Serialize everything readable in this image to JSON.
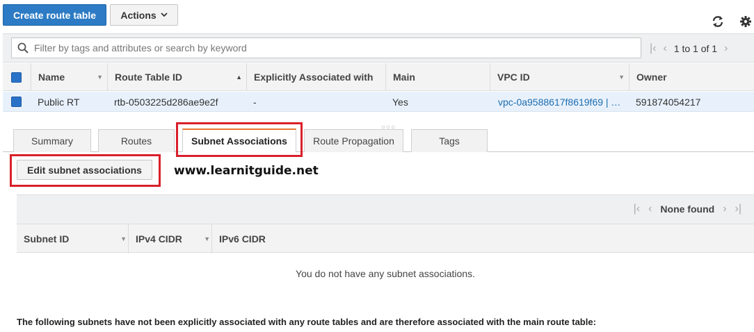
{
  "toolbar": {
    "create_label": "Create route table",
    "actions_label": "Actions",
    "icons": [
      "refresh-icon",
      "gear-icon",
      "caret-down-icon"
    ]
  },
  "filter": {
    "placeholder": "Filter by tags and attributes or search by keyword",
    "pagination": "1 to 1 of 1"
  },
  "table": {
    "columns": [
      "Name",
      "Route Table ID",
      "Explicitly Associated with",
      "Main",
      "VPC ID",
      "Owner"
    ],
    "rows": [
      {
        "name": "Public RT",
        "route_table_id": "rtb-0503225d286ae9e2f",
        "explicitly_associated": "-",
        "main": "Yes",
        "vpc_id": "vpc-0a9588617f8619f69 | …",
        "owner": "591874054217"
      }
    ]
  },
  "tabs": [
    {
      "label": "Summary",
      "active": false
    },
    {
      "label": "Routes",
      "active": false
    },
    {
      "label": "Subnet Associations",
      "active": true
    },
    {
      "label": "Route Propagation",
      "active": false
    },
    {
      "label": "Tags",
      "active": false
    }
  ],
  "subnet_panel": {
    "edit_label": "Edit subnet associations",
    "watermark": "www.learnitguide.net",
    "pagination": "None found",
    "columns": [
      "Subnet ID",
      "IPv4 CIDR",
      "IPv6 CIDR"
    ],
    "empty_message": "You do not have any subnet associations.",
    "footer_note": "The following subnets have not been explicitly associated with any route tables and are therefore associated with the main route table:"
  },
  "colors": {
    "primary": "#2c7bc4",
    "highlight": "#d9202a",
    "active_tab_accent": "#e6772e",
    "link": "#1c6cb0"
  }
}
